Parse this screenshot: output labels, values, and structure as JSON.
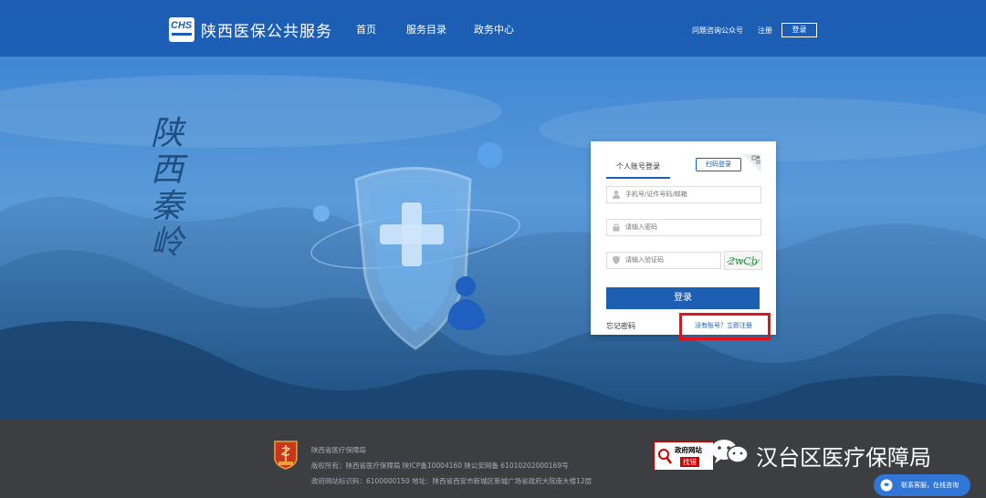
{
  "header": {
    "logo_text": "CHS",
    "title": "陕西医保公共服务",
    "nav": [
      "首页",
      "服务目录",
      "政务中心"
    ],
    "follow_link": "问题咨询公众号",
    "register_link": "注册",
    "login_button": "登录"
  },
  "hero": {
    "calligraphy": [
      "陕",
      "西",
      "秦",
      "岭"
    ]
  },
  "login": {
    "tab_personal": "个人账号登录",
    "scan_login": "扫码登录",
    "username_placeholder": "手机号/证件号码/邮箱",
    "password_placeholder": "请输入密码",
    "captcha_placeholder": "请输入验证码",
    "captcha_text": "2wCb",
    "submit": "登录",
    "forgot_password": "忘记密码",
    "register_prompt": "没有账号？立即注册"
  },
  "footer": {
    "org_name": "陕西省医疗保障局",
    "copyright": "版权所有：陕西省医疗保障局    陕ICP备10004160    陕公安网备 61010202000169号",
    "site_code": "政府网站标识码：6100000150    地址：陕西省西安市新城区新城广场省政府大院南大楼12层",
    "gov_badge_top": "政府网站",
    "gov_badge_bottom": "找错",
    "watermark": "汉台区医疗保障局",
    "chat_button": "联系客服，在线咨询"
  },
  "colors": {
    "primary": "#1d5eb3",
    "footer_bg": "#3c3e41",
    "highlight": "#e0141d"
  }
}
